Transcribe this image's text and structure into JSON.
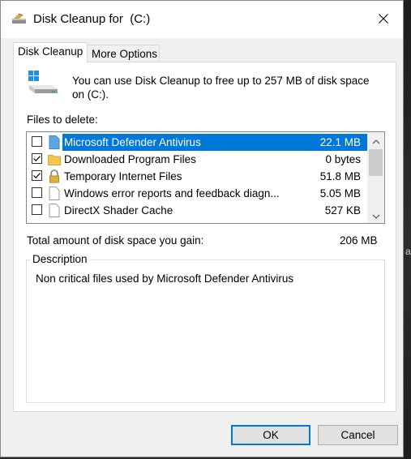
{
  "window": {
    "title": "Disk Cleanup for  (C:)"
  },
  "tabs": [
    {
      "label": "Disk Cleanup",
      "active": true
    },
    {
      "label": "More Options",
      "active": false
    }
  ],
  "intro": "You can use Disk Cleanup to free up to 257 MB of disk space on (C:).",
  "files_label": "Files to delete:",
  "files": [
    {
      "name": "Microsoft Defender Antivirus",
      "size": "22.1 MB",
      "checked": false,
      "selected": true,
      "icon": "document-blue-icon"
    },
    {
      "name": "Downloaded Program Files",
      "size": "0 bytes",
      "checked": true,
      "selected": false,
      "icon": "folder-icon"
    },
    {
      "name": "Temporary Internet Files",
      "size": "51.8 MB",
      "checked": true,
      "selected": false,
      "icon": "lock-icon"
    },
    {
      "name": "Windows error reports and feedback diagn...",
      "size": "5.05 MB",
      "checked": false,
      "selected": false,
      "icon": "document-icon"
    },
    {
      "name": "DirectX Shader Cache",
      "size": "527 KB",
      "checked": false,
      "selected": false,
      "icon": "document-icon"
    }
  ],
  "total": {
    "label": "Total amount of disk space you gain:",
    "value": "206 MB"
  },
  "description": {
    "legend": "Description",
    "text": "Non critical files used by Microsoft Defender Antivirus"
  },
  "buttons": {
    "ok": "OK",
    "cancel": "Cancel"
  },
  "background_char": "a",
  "colors": {
    "selection": "#0078d7",
    "window_bg": "#f0f0f0",
    "panel_bg": "#ffffff"
  }
}
